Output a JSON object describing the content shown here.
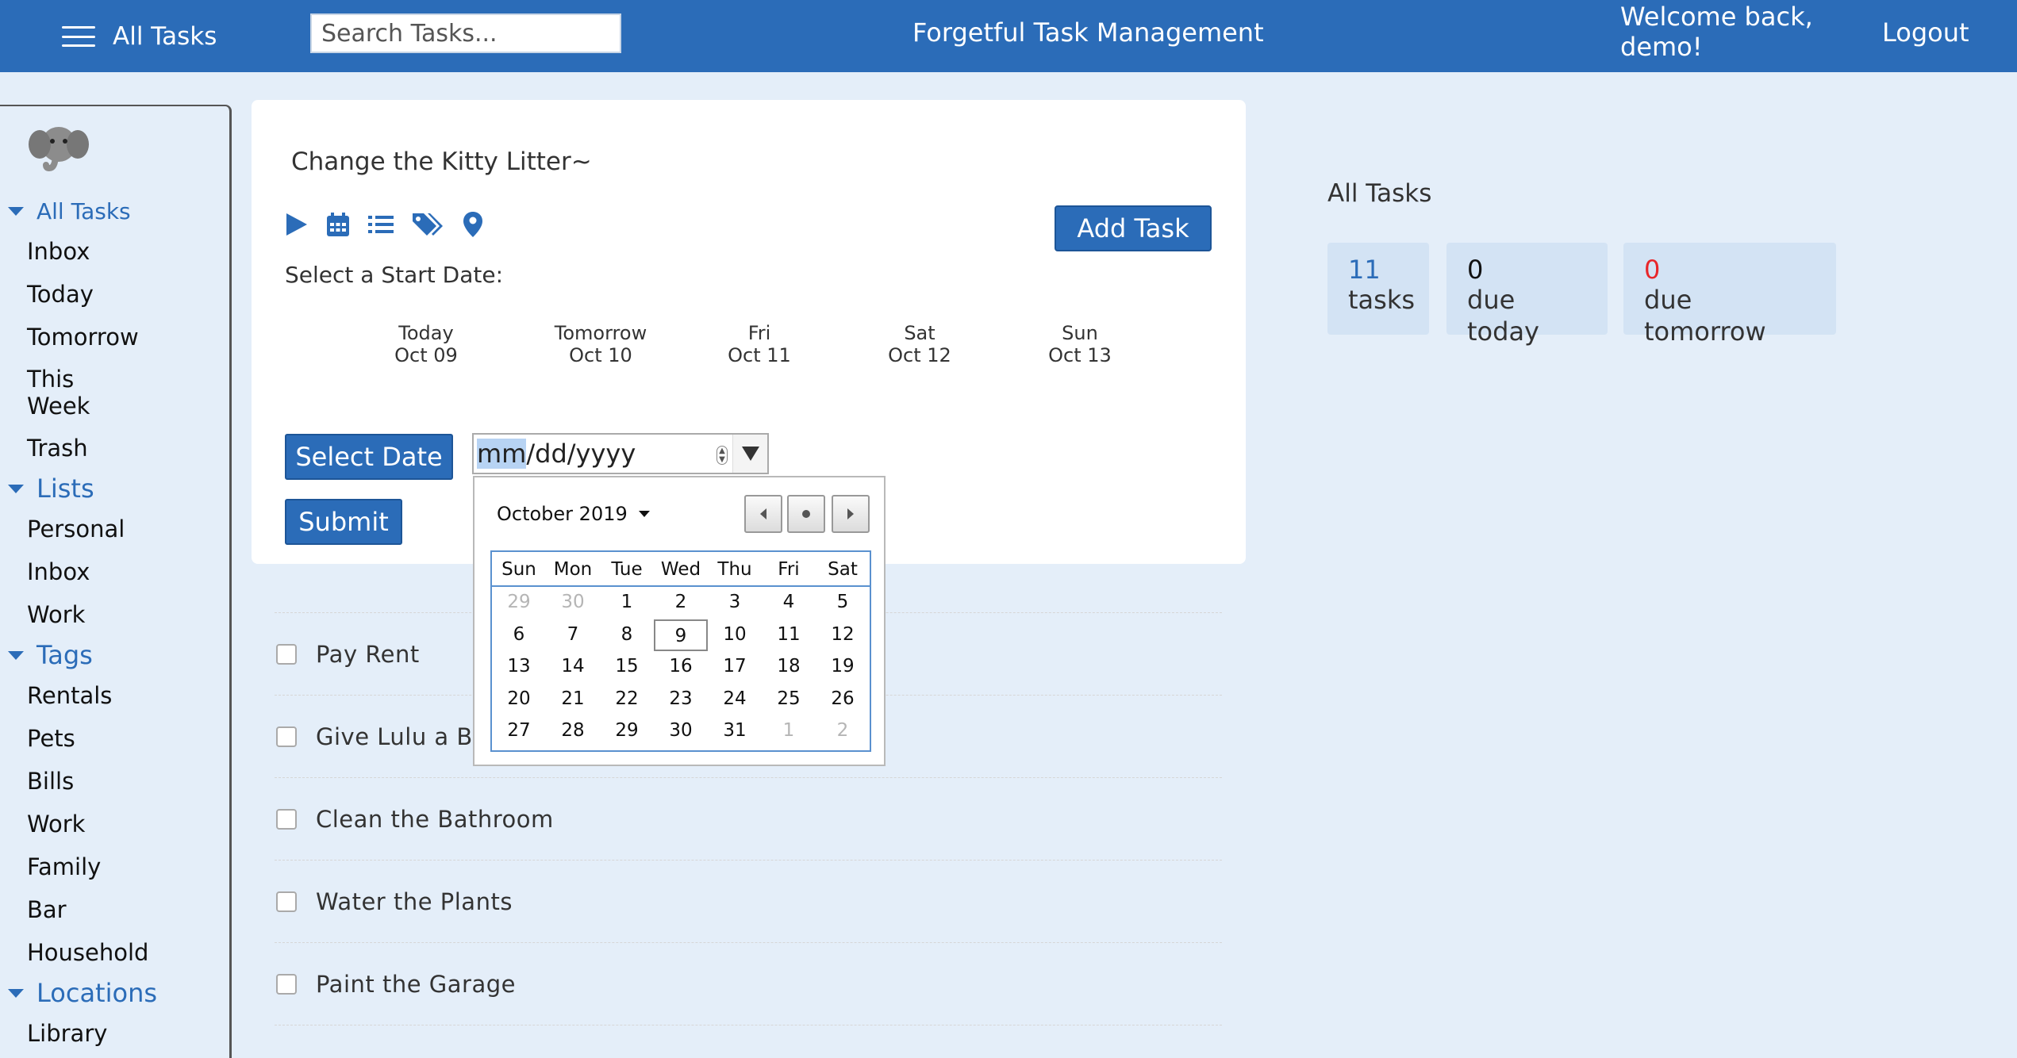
{
  "header": {
    "menu_label": "All Tasks",
    "search_placeholder": "Search Tasks...",
    "app_title": "Forgetful Task Management",
    "welcome": "Welcome back, demo!",
    "logout": "Logout"
  },
  "sidebar": {
    "all_tasks": "All Tasks",
    "all_items": [
      "Inbox",
      "Today",
      "Tomorrow",
      "This Week",
      "Trash"
    ],
    "lists_label": "Lists",
    "lists": [
      "Personal",
      "Inbox",
      "Work"
    ],
    "tags_label": "Tags",
    "tags": [
      "Rentals",
      "Pets",
      "Bills",
      "Work",
      "Family",
      "Bar",
      "Household"
    ],
    "locations_label": "Locations",
    "locations": [
      "Library"
    ]
  },
  "main": {
    "task_title": "Change the Kitty Litter~",
    "add_task": "Add Task",
    "start_label": "Select a Start Date:",
    "quick_dates": [
      {
        "day": "Today",
        "date": "Oct 09"
      },
      {
        "day": "Tomorrow",
        "date": "Oct 10"
      },
      {
        "day": "Fri",
        "date": "Oct 11"
      },
      {
        "day": "Sat",
        "date": "Oct 12"
      },
      {
        "day": "Sun",
        "date": "Oct 13"
      }
    ],
    "select_date": "Select Date",
    "submit": "Submit",
    "date_input": {
      "mm": "mm",
      "rest": "/dd/yyyy"
    },
    "tasks": [
      "Pay Rent",
      "Give Lulu a Ba",
      "Clean the Bathroom",
      "Water the Plants",
      "Paint the Garage"
    ]
  },
  "calendar": {
    "month_label": "October 2019",
    "weekdays": [
      "Sun",
      "Mon",
      "Tue",
      "Wed",
      "Thu",
      "Fri",
      "Sat"
    ],
    "weeks": [
      [
        "29",
        "30",
        "1",
        "2",
        "3",
        "4",
        "5"
      ],
      [
        "6",
        "7",
        "8",
        "9",
        "10",
        "11",
        "12"
      ],
      [
        "13",
        "14",
        "15",
        "16",
        "17",
        "18",
        "19"
      ],
      [
        "20",
        "21",
        "22",
        "23",
        "24",
        "25",
        "26"
      ],
      [
        "27",
        "28",
        "29",
        "30",
        "31",
        "1",
        "2"
      ]
    ],
    "today": "9"
  },
  "stats": {
    "title": "All Tasks",
    "items": [
      {
        "num": "11",
        "label": "tasks",
        "color": "#2b6cb8"
      },
      {
        "num": "0",
        "label": "due today",
        "color": "#111111"
      },
      {
        "num": "0",
        "label": "due tomorrow",
        "color": "#e8262a"
      }
    ]
  },
  "colors": {
    "brand": "#2b6cb8",
    "background": "#e4eef9",
    "alert": "#e8262a"
  }
}
